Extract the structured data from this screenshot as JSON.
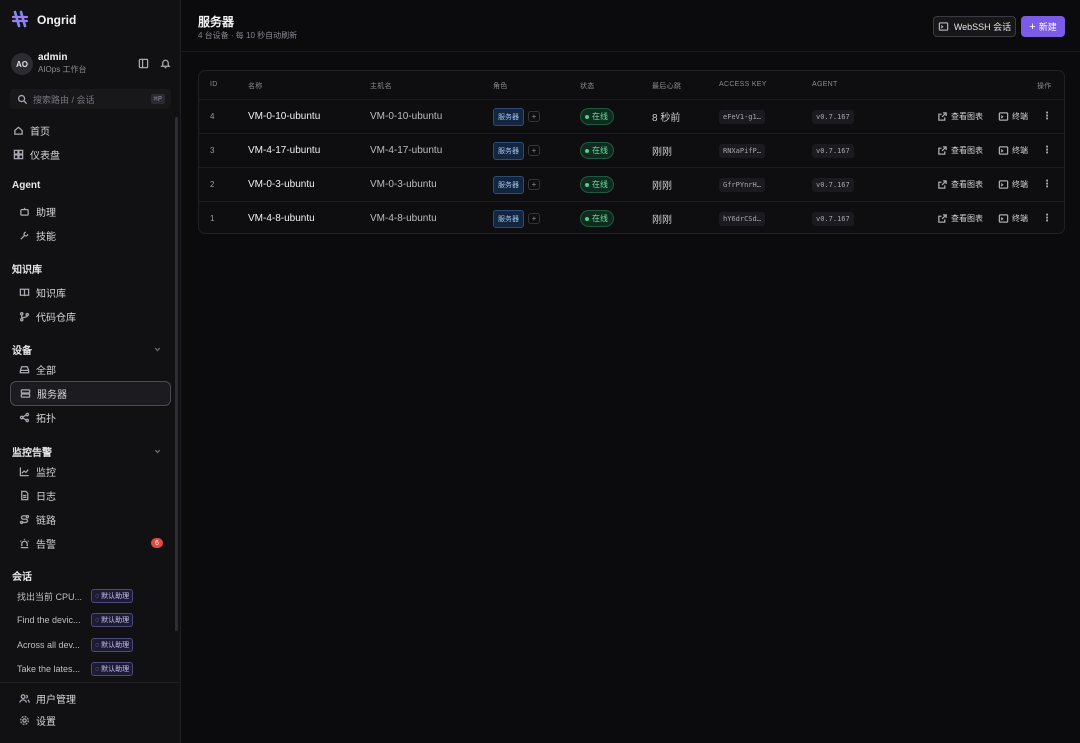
{
  "brand": {
    "name": "Ongrid"
  },
  "user": {
    "avatar": "AO",
    "name": "admin",
    "workspace": "AIOps 工作台"
  },
  "search": {
    "placeholder": "搜索路由 / 会话",
    "shortcut": "⌘P"
  },
  "nav_top": [
    {
      "label": "首页",
      "icon": "home-icon"
    },
    {
      "label": "仪表盘",
      "icon": "dashboard-icon"
    }
  ],
  "sections": {
    "agent": {
      "title": "Agent",
      "items": [
        {
          "label": "助理",
          "icon": "bot-icon"
        },
        {
          "label": "技能",
          "icon": "wrench-icon"
        }
      ]
    },
    "knowledge": {
      "title": "知识库",
      "items": [
        {
          "label": "知识库",
          "icon": "book-icon"
        },
        {
          "label": "代码仓库",
          "icon": "git-branch-icon"
        }
      ]
    },
    "devices": {
      "title": "设备",
      "items": [
        {
          "label": "全部",
          "icon": "drive-icon"
        },
        {
          "label": "服务器",
          "icon": "server-icon",
          "active": true
        },
        {
          "label": "拓扑",
          "icon": "share-icon"
        }
      ]
    },
    "monitoring": {
      "title": "监控告警",
      "items": [
        {
          "label": "监控",
          "icon": "chart-line-icon"
        },
        {
          "label": "日志",
          "icon": "file-icon"
        },
        {
          "label": "链路",
          "icon": "route-icon"
        },
        {
          "label": "告警",
          "icon": "siren-icon",
          "badge": "6"
        }
      ]
    },
    "conversations": {
      "title": "会话",
      "items": [
        {
          "title": "找出当前 CPU...",
          "tag": "默认助理"
        },
        {
          "title": "Find the devic...",
          "tag": "默认助理"
        },
        {
          "title": "Across all dev...",
          "tag": "默认助理"
        },
        {
          "title": "Take the lates...",
          "tag": "默认助理"
        }
      ]
    }
  },
  "bottom_nav": [
    {
      "label": "用户管理",
      "icon": "users-icon"
    },
    {
      "label": "设置",
      "icon": "settings-icon"
    }
  ],
  "header": {
    "title": "服务器",
    "subtitle": "4 台设备 · 每 10 秒自动刷新",
    "webssh_label": "WebSSH 会话",
    "new_label": "新建"
  },
  "table": {
    "columns": {
      "id": "ID",
      "name": "名称",
      "hostname": "主机名",
      "role": "角色",
      "status": "状态",
      "heartbeat": "最后心跳",
      "access_key": "ACCESS KEY",
      "agent": "AGENT",
      "actions": "操作"
    },
    "rows": [
      {
        "id": "4",
        "name": "VM-0-10-ubuntu",
        "hostname": "VM-0-10-ubuntu",
        "role": "服务器",
        "status": "在线",
        "heartbeat": "8 秒前",
        "access_key": "eFeV1-g1…",
        "agent": "v0.7.167",
        "chart_label": "查看图表",
        "terminal_label": "终端"
      },
      {
        "id": "3",
        "name": "VM-4-17-ubuntu",
        "hostname": "VM-4-17-ubuntu",
        "role": "服务器",
        "status": "在线",
        "heartbeat": "刚刚",
        "access_key": "RNXaPifP…",
        "agent": "v0.7.167",
        "chart_label": "查看图表",
        "terminal_label": "终端"
      },
      {
        "id": "2",
        "name": "VM-0-3-ubuntu",
        "hostname": "VM-0-3-ubuntu",
        "role": "服务器",
        "status": "在线",
        "heartbeat": "刚刚",
        "access_key": "GfrPYnrH…",
        "agent": "v0.7.167",
        "chart_label": "查看图表",
        "terminal_label": "终端"
      },
      {
        "id": "1",
        "name": "VM-4-8-ubuntu",
        "hostname": "VM-4-8-ubuntu",
        "role": "服务器",
        "status": "在线",
        "heartbeat": "刚刚",
        "access_key": "hY6drCSd…",
        "agent": "v0.7.167",
        "chart_label": "查看图表",
        "terminal_label": "终端"
      }
    ]
  }
}
